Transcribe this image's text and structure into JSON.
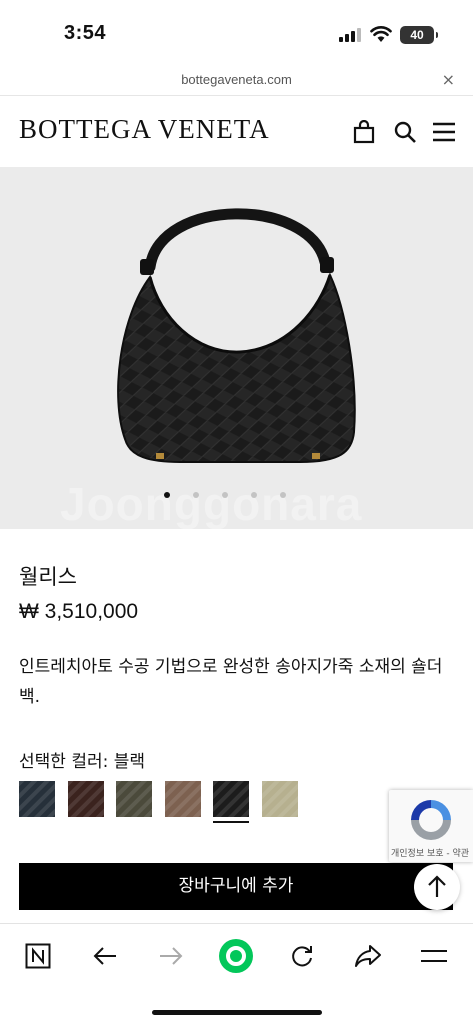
{
  "status_bar": {
    "time": "3:54",
    "battery": "40"
  },
  "browser": {
    "url": "bottegaveneta.com",
    "close_glyph": "×"
  },
  "header": {
    "logo": "BOTTEGA VENETA",
    "icons": [
      "shopping-bag-icon",
      "search-icon",
      "menu-icon"
    ]
  },
  "gallery": {
    "watermark": "Joonggonara",
    "slide_count": 5,
    "active_slide": 1
  },
  "product": {
    "name": "월리스",
    "price": "₩ 3,510,000",
    "description": "인트레치아토 수공 기법으로 완성한 송아지가죽 소재의 숄더 백.",
    "color_label": "선택한 컬러: 블랙",
    "swatches": [
      {
        "color": "#26303a"
      },
      {
        "color": "#3b231e"
      },
      {
        "color": "#4b4a3b"
      },
      {
        "color": "#7d6150"
      },
      {
        "color": "#1c1c1c",
        "selected": true
      },
      {
        "color": "#b6b08f"
      }
    ]
  },
  "recaptcha": {
    "text": "개인정보 보호 - 약관"
  },
  "actions": {
    "add_to_cart": "장바구니에 추가"
  },
  "toolbar": {
    "items": [
      "naver-n-icon",
      "back-arrow-icon",
      "forward-arrow-icon",
      "green-dot-icon",
      "refresh-icon",
      "share-icon",
      "hamburger-menu-icon"
    ]
  }
}
